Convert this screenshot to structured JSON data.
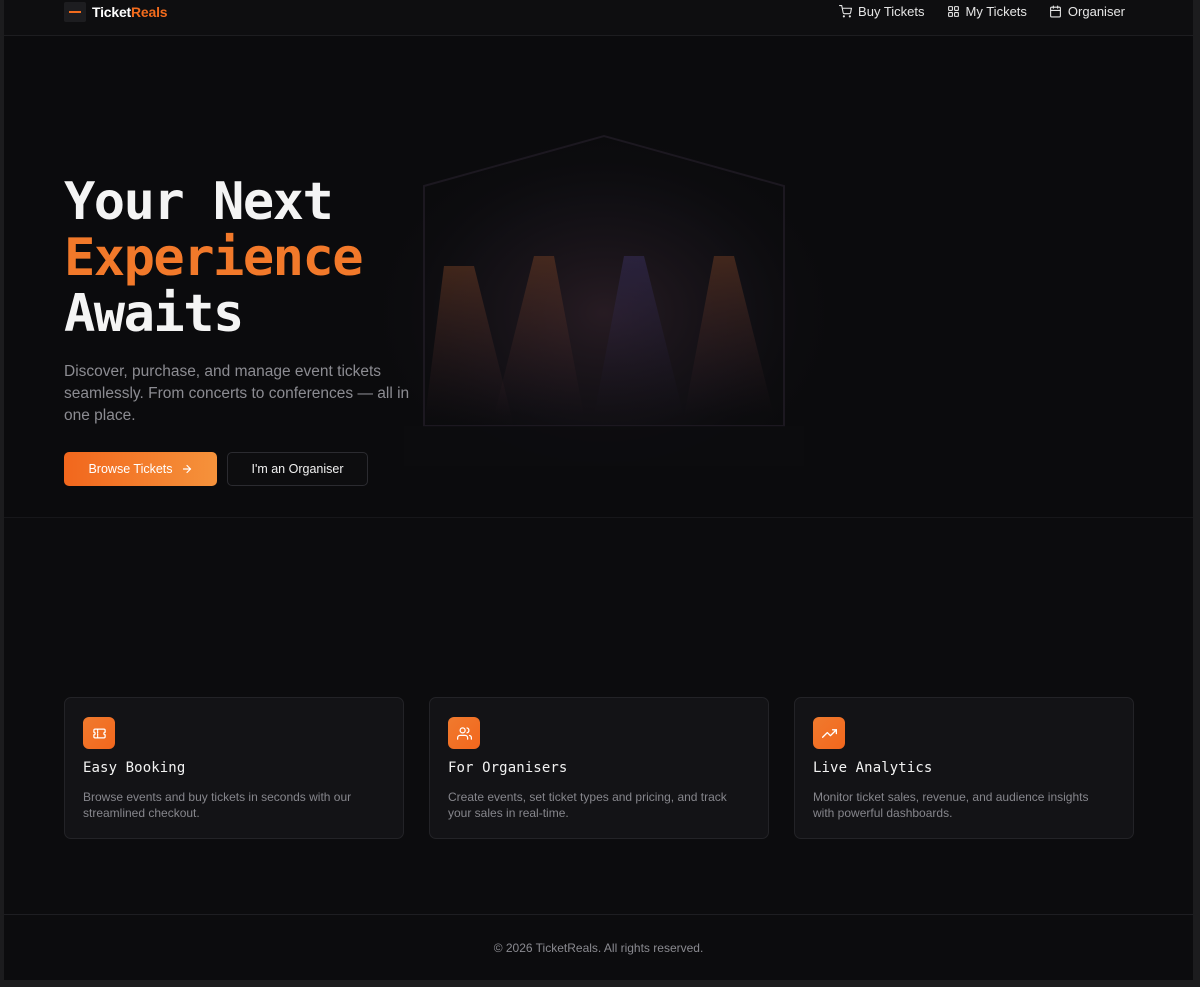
{
  "nav": {
    "brand_part1": "Ticket",
    "brand_part2": "Reals",
    "links": [
      {
        "label": "Buy Tickets",
        "icon": "cart-icon"
      },
      {
        "label": "My Tickets",
        "icon": "grid-icon"
      },
      {
        "label": "Organiser",
        "icon": "calendar-icon"
      }
    ]
  },
  "hero": {
    "title_line1": "Your Next",
    "title_line2": "Experience",
    "title_line3": "Awaits",
    "subtitle": "Discover, purchase, and manage event tickets seamlessly. From concerts to conferences — all in one place.",
    "primary_button": "Browse Tickets",
    "secondary_button": "I'm an Organiser"
  },
  "features": [
    {
      "icon": "ticket-icon",
      "title": "Easy Booking",
      "desc": "Browse events and buy tickets in seconds with our streamlined checkout."
    },
    {
      "icon": "users-icon",
      "title": "For Organisers",
      "desc": "Create events, set ticket types and pricing, and track your sales in real-time."
    },
    {
      "icon": "trending-up-icon",
      "title": "Live Analytics",
      "desc": "Monitor ticket sales, revenue, and audience insights with powerful dashboards."
    }
  ],
  "footer": {
    "text": "© 2026 TicketReals. All rights reserved."
  },
  "colors": {
    "accent": "#f26b1d",
    "background": "#0c0c0e",
    "card": "#131316"
  }
}
